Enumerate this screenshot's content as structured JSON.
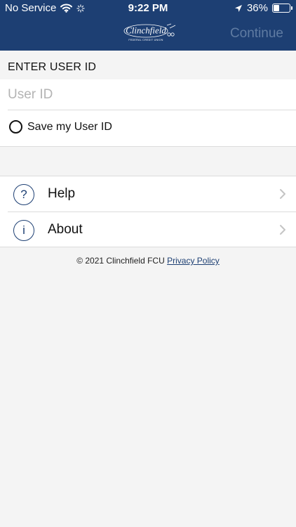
{
  "status_bar": {
    "carrier": "No Service",
    "time": "9:22 PM",
    "battery": "36%"
  },
  "header": {
    "logo_text": "Clinchfield",
    "logo_subtext": "FEDERAL CREDIT UNION",
    "continue_label": "Continue"
  },
  "form": {
    "section_label": "ENTER USER ID",
    "userid_placeholder": "User ID",
    "save_label": "Save my User ID"
  },
  "menu": {
    "items": [
      {
        "label": "Help",
        "icon_glyph": "?",
        "icon": "question-icon"
      },
      {
        "label": "About",
        "icon_glyph": "i",
        "icon": "info-icon"
      }
    ]
  },
  "footer": {
    "copyright": "© 2021 Clinchfield FCU",
    "privacy_link": "Privacy Policy"
  },
  "colors": {
    "header_bg": "#1d3f73",
    "continue_disabled": "#5f7ba2",
    "background": "#f4f4f4",
    "icon": "#1d3f73"
  }
}
